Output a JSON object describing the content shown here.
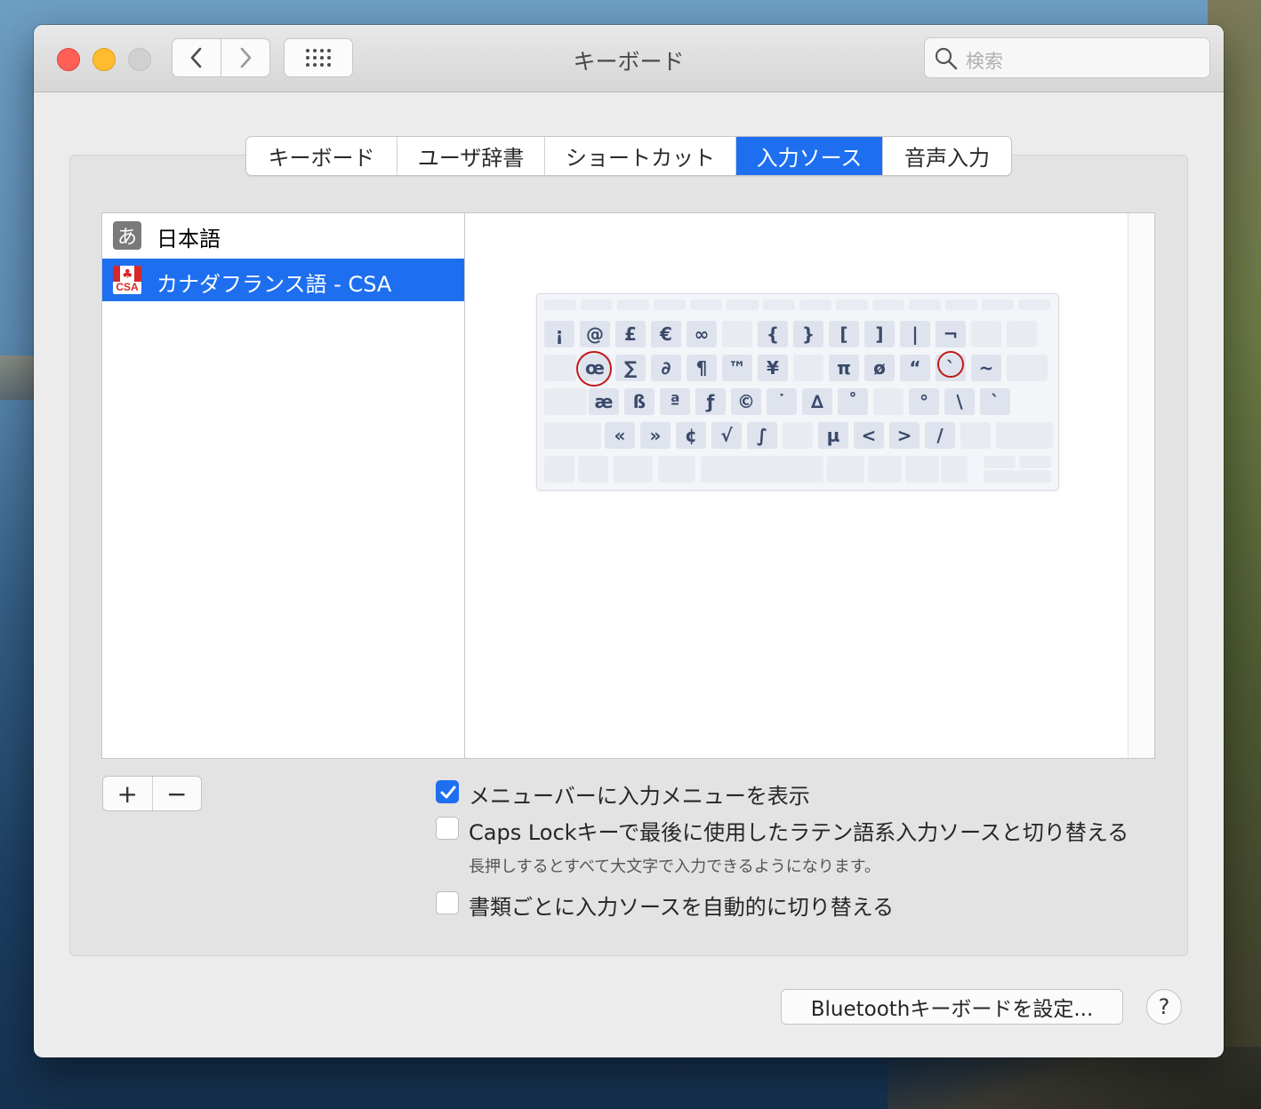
{
  "window": {
    "title": "キーボード",
    "search_placeholder": "検索"
  },
  "tabs": [
    {
      "label": "キーボード",
      "active": false
    },
    {
      "label": "ユーザ辞書",
      "active": false
    },
    {
      "label": "ショートカット",
      "active": false
    },
    {
      "label": "入力ソース",
      "active": true
    },
    {
      "label": "音声入力",
      "active": false
    }
  ],
  "input_sources": [
    {
      "icon": "あ",
      "label": "日本語",
      "selected": false
    },
    {
      "icon": "CSA",
      "label": "カナダフランス語 - CSA",
      "selected": true
    }
  ],
  "keyboard": {
    "row1": [
      "¡",
      "@",
      "£",
      "€",
      "∞",
      "",
      "{",
      "}",
      "[",
      "]",
      "|",
      "¬"
    ],
    "row2": [
      "œ",
      "∑",
      "∂",
      "¶",
      "™",
      "¥",
      "",
      "π",
      "ø",
      "“",
      "`",
      "~"
    ],
    "row3": [
      "æ",
      "ß",
      "ª",
      "ƒ",
      "©",
      "˙",
      "∆",
      "˚",
      "",
      "°",
      "\\",
      "`"
    ],
    "row4": [
      "«",
      "»",
      "¢",
      "√",
      "∫",
      "",
      "µ",
      "<",
      ">",
      "/"
    ],
    "highlighted_keys": [
      "œ",
      "`"
    ]
  },
  "controls": {
    "add": "+",
    "remove": "−"
  },
  "options": {
    "show_menu": {
      "label": "メニューバーに入力メニューを表示",
      "checked": true
    },
    "caps_lock": {
      "label": "Caps Lockキーで最後に使用したラテン語系入力ソースと切り替える",
      "checked": false
    },
    "caps_lock_note": "長押しするとすべて大文字で入力できるようになります。",
    "auto_switch": {
      "label": "書類ごとに入力ソースを自動的に切り替える",
      "checked": false
    }
  },
  "footer": {
    "bluetooth_button": "Bluetoothキーボードを設定...",
    "help_button": "?"
  },
  "colors": {
    "accent": "#1e6ff0",
    "highlight_circle": "#c01818"
  }
}
